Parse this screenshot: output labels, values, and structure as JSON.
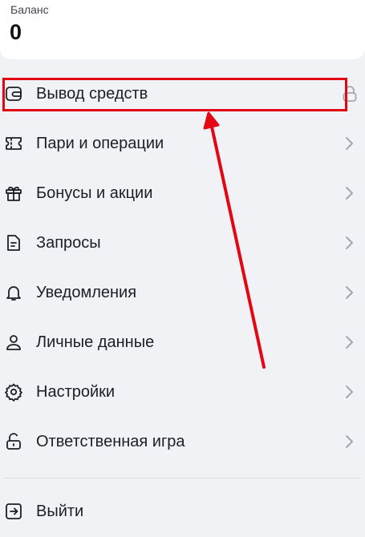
{
  "balance": {
    "label": "Баланс",
    "value": "0"
  },
  "menu": {
    "items": [
      {
        "label": "Вывод средств",
        "icon": "wallet-icon",
        "trailing": "lock-icon"
      },
      {
        "label": "Пари и операции",
        "icon": "ticket-icon",
        "trailing": "chevron-right-icon"
      },
      {
        "label": "Бонусы и акции",
        "icon": "gift-icon",
        "trailing": "chevron-right-icon"
      },
      {
        "label": "Запросы",
        "icon": "document-icon",
        "trailing": "chevron-right-icon"
      },
      {
        "label": "Уведомления",
        "icon": "bell-icon",
        "trailing": "chevron-right-icon"
      },
      {
        "label": "Личные данные",
        "icon": "user-icon",
        "trailing": "chevron-right-icon"
      },
      {
        "label": "Настройки",
        "icon": "gear-icon",
        "trailing": "chevron-right-icon"
      },
      {
        "label": "Ответственная игра",
        "icon": "padlock-icon",
        "trailing": "chevron-right-icon"
      }
    ],
    "logout": {
      "label": "Выйти",
      "icon": "logout-icon"
    }
  },
  "colors": {
    "annotation": "#e30613",
    "text": "#1b1f24",
    "background": "#f1f2f5",
    "chevron": "#a3a8b0"
  }
}
